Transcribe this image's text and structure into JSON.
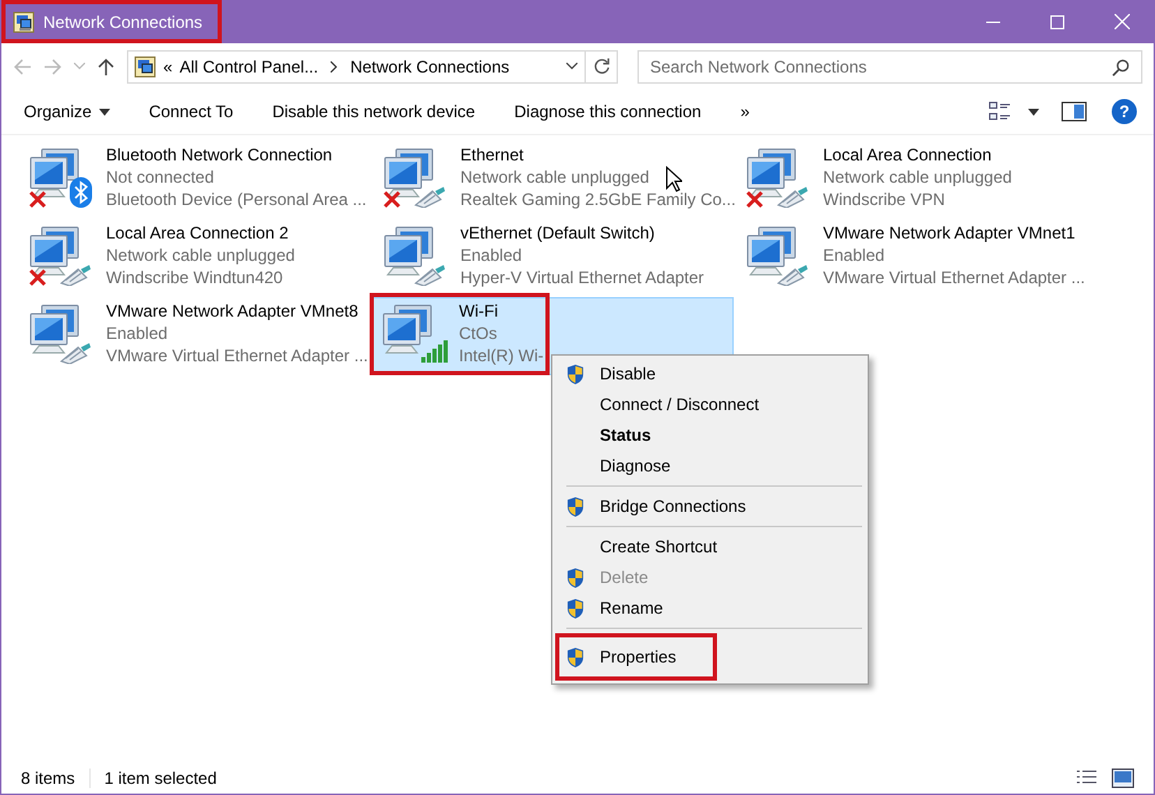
{
  "window": {
    "title": "Network Connections",
    "title_highlighted": true
  },
  "address_bar": {
    "overflow": "«",
    "crumbs": [
      "All Control Panel...",
      "Network Connections"
    ]
  },
  "search": {
    "placeholder": "Search Network Connections"
  },
  "toolbar": {
    "organize": "Organize",
    "commands": [
      "Connect To",
      "Disable this network device",
      "Diagnose this connection"
    ],
    "more": "»",
    "help": "?"
  },
  "connections": [
    {
      "name": "Bluetooth Network Connection",
      "status": "Not connected",
      "device": "Bluetooth Device (Personal Area ...",
      "kind": "bluetooth",
      "disconnected": true,
      "selected": false,
      "highlighted": false
    },
    {
      "name": "Ethernet",
      "status": "Network cable unplugged",
      "device": "Realtek Gaming 2.5GbE Family Co...",
      "kind": "ethernet",
      "disconnected": true,
      "selected": false,
      "highlighted": false
    },
    {
      "name": "Local Area Connection",
      "status": "Network cable unplugged",
      "device": "Windscribe VPN",
      "kind": "ethernet",
      "disconnected": true,
      "selected": false,
      "highlighted": false
    },
    {
      "name": "Local Area Connection 2",
      "status": "Network cable unplugged",
      "device": "Windscribe Windtun420",
      "kind": "ethernet",
      "disconnected": true,
      "selected": false,
      "highlighted": false
    },
    {
      "name": "vEthernet (Default Switch)",
      "status": "Enabled",
      "device": "Hyper-V Virtual Ethernet Adapter",
      "kind": "ethernet",
      "disconnected": false,
      "selected": false,
      "highlighted": false
    },
    {
      "name": "VMware Network Adapter VMnet1",
      "status": "Enabled",
      "device": "VMware Virtual Ethernet Adapter ...",
      "kind": "ethernet",
      "disconnected": false,
      "selected": false,
      "highlighted": false
    },
    {
      "name": "VMware Network Adapter VMnet8",
      "status": "Enabled",
      "device": "VMware Virtual Ethernet Adapter ...",
      "kind": "ethernet",
      "disconnected": false,
      "selected": false,
      "highlighted": false
    },
    {
      "name": "Wi-Fi",
      "status": "CtOs",
      "device": "Intel(R) Wi-",
      "kind": "wifi",
      "disconnected": false,
      "selected": true,
      "highlighted": true
    }
  ],
  "context_menu": [
    {
      "kind": "item",
      "label": "Disable",
      "shield": true,
      "bold": false,
      "disabled": false,
      "highlighted": false
    },
    {
      "kind": "item",
      "label": "Connect / Disconnect",
      "shield": false,
      "bold": false,
      "disabled": false,
      "highlighted": false
    },
    {
      "kind": "item",
      "label": "Status",
      "shield": false,
      "bold": true,
      "disabled": false,
      "highlighted": false
    },
    {
      "kind": "item",
      "label": "Diagnose",
      "shield": false,
      "bold": false,
      "disabled": false,
      "highlighted": false
    },
    {
      "kind": "separator"
    },
    {
      "kind": "item",
      "label": "Bridge Connections",
      "shield": true,
      "bold": false,
      "disabled": false,
      "highlighted": false
    },
    {
      "kind": "separator"
    },
    {
      "kind": "item",
      "label": "Create Shortcut",
      "shield": false,
      "bold": false,
      "disabled": false,
      "highlighted": false
    },
    {
      "kind": "item",
      "label": "Delete",
      "shield": true,
      "bold": false,
      "disabled": true,
      "highlighted": false
    },
    {
      "kind": "item",
      "label": "Rename",
      "shield": true,
      "bold": false,
      "disabled": false,
      "highlighted": false
    },
    {
      "kind": "separator"
    },
    {
      "kind": "item",
      "label": "Properties",
      "shield": true,
      "bold": false,
      "disabled": false,
      "highlighted": true
    }
  ],
  "status_bar": {
    "count": "8 items",
    "selection": "1 item selected"
  }
}
